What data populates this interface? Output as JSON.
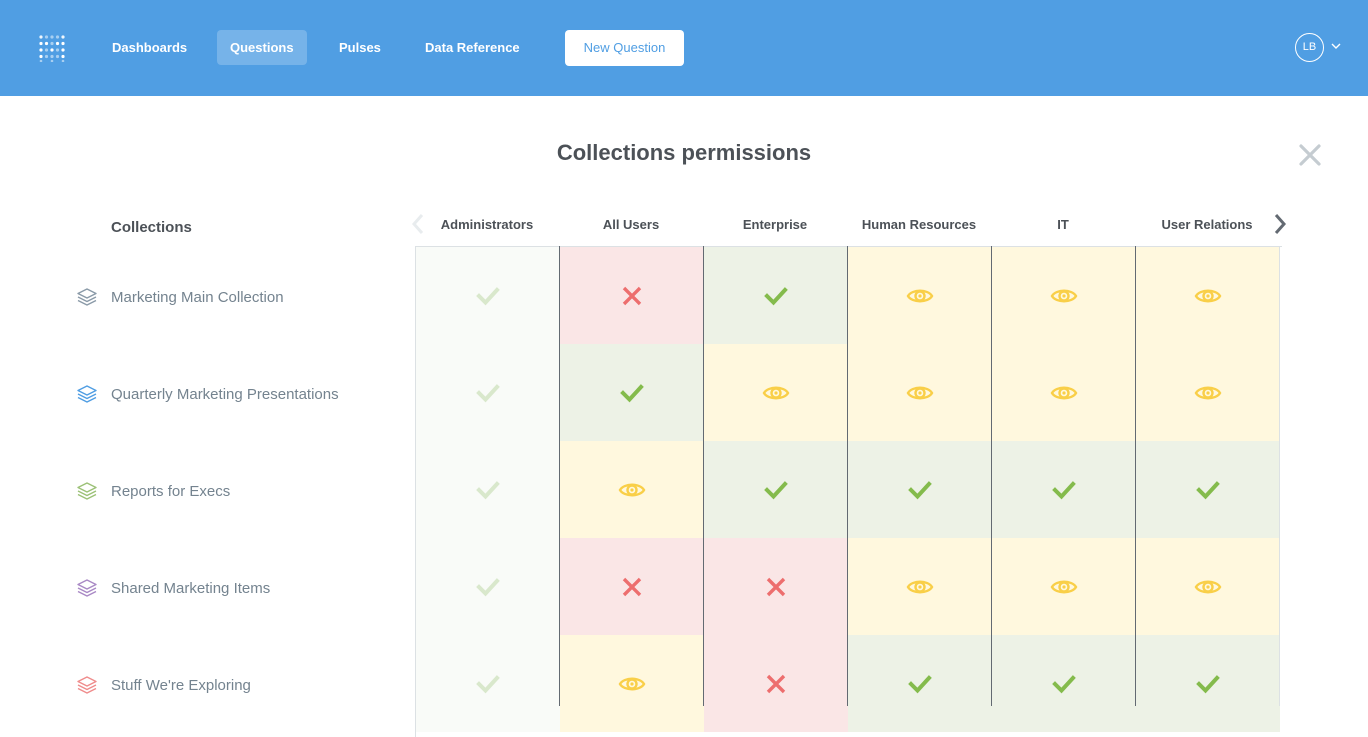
{
  "nav": {
    "items": [
      {
        "label": "Dashboards",
        "active": false
      },
      {
        "label": "Questions",
        "active": true
      },
      {
        "label": "Pulses",
        "active": false
      },
      {
        "label": "Data Reference",
        "active": false
      }
    ],
    "new_question_label": "New Question",
    "avatar_initials": "LB"
  },
  "modal": {
    "title": "Collections permissions"
  },
  "collections": {
    "header": "Collections",
    "items": [
      {
        "name": "Marketing Main Collection",
        "color": "#8a9aa8"
      },
      {
        "name": "Quarterly Marketing Presentations",
        "color": "#509ee3"
      },
      {
        "name": "Reports for Execs",
        "color": "#9cc177"
      },
      {
        "name": "Shared Marketing Items",
        "color": "#a989c5"
      },
      {
        "name": "Stuff We're Exploring",
        "color": "#ef8c8c"
      }
    ]
  },
  "groups": [
    "Administrators",
    "All Users",
    "Enterprise",
    "Human Resources",
    "IT",
    "User Relations"
  ],
  "permissions": [
    [
      "admin",
      "none",
      "write",
      "read",
      "read",
      "read"
    ],
    [
      "admin",
      "write",
      "read",
      "read",
      "read",
      "read"
    ],
    [
      "admin",
      "read",
      "write",
      "write",
      "write",
      "write"
    ],
    [
      "admin",
      "none",
      "none",
      "read",
      "read",
      "read"
    ],
    [
      "admin",
      "read",
      "none",
      "write",
      "write",
      "write"
    ]
  ],
  "colors": {
    "brand": "#509ee3",
    "write_bg": "#edf2e6",
    "write_icon": "#84bb4c",
    "read_bg": "#fff8de",
    "read_icon": "#f9cf48",
    "none_bg": "#fae6e6",
    "none_icon": "#ed6e6e",
    "admin_icon": "#d9e8cc"
  },
  "icons": {
    "logo": "metabase-logo-icon",
    "collection": "collection-stack-icon",
    "write": "check-icon",
    "read": "eye-icon",
    "none": "close-icon"
  }
}
